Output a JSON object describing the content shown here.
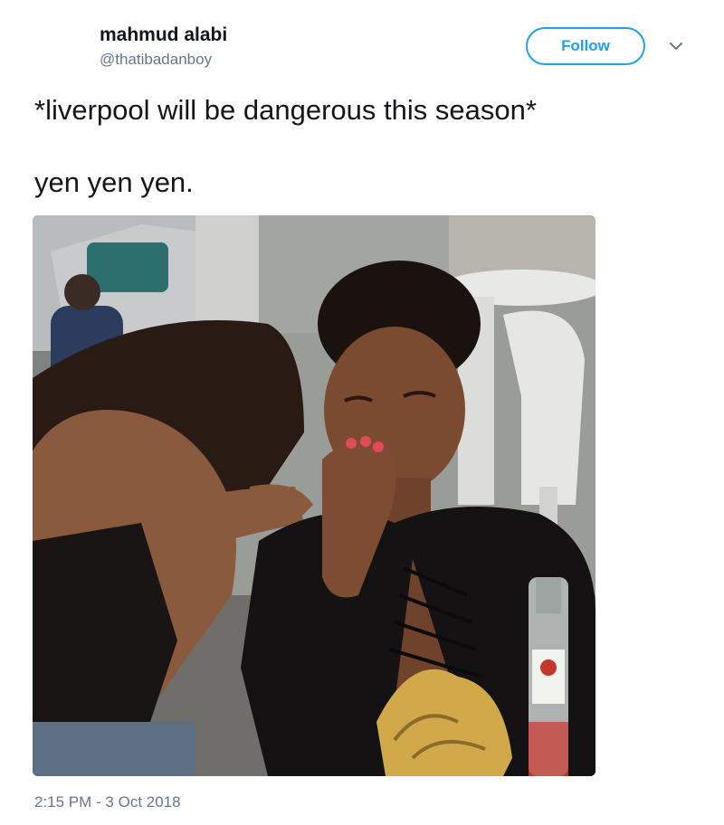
{
  "author": {
    "display_name": "mahmud alabi",
    "handle": "@thatibadanboy"
  },
  "actions": {
    "follow_label": "Follow",
    "more_icon": "chevron-down-icon"
  },
  "tweet": {
    "text": "*liverpool will be dangerous this season*\n\nyen yen yen.",
    "timestamp": "2:15 PM - 3 Oct 2018"
  },
  "colors": {
    "accent": "#1da1f2",
    "text": "#14171a",
    "secondary": "#657786"
  }
}
